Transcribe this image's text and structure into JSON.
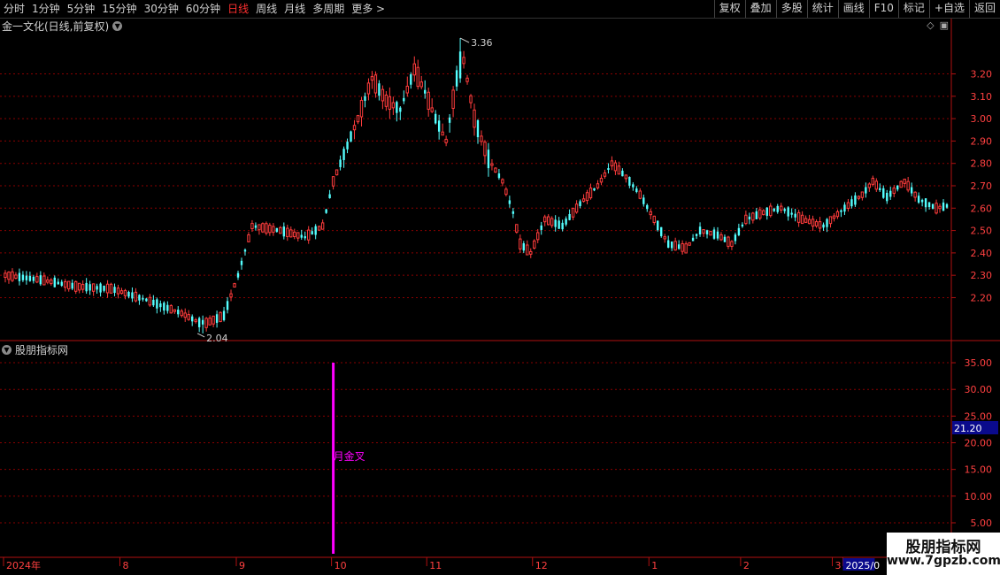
{
  "toolbar": {
    "periods": [
      "分时",
      "1分钟",
      "5分钟",
      "15分钟",
      "30分钟",
      "60分钟",
      "日线",
      "周线",
      "月线",
      "多周期",
      "更多 >"
    ],
    "active_period": "日线",
    "buttons": [
      "复权",
      "叠加",
      "多股",
      "统计",
      "画线",
      "F10",
      "标记",
      "+自选",
      "返回"
    ]
  },
  "stock_title": "金一文化(日线,前复权)",
  "indicator_title": "股朋指标网",
  "watermark": {
    "line1": "股朋指标网",
    "line2": "www.7gpzb.com"
  },
  "colors": {
    "up": "#ff3c3c",
    "down": "#54ffff",
    "grid": "#8a0000",
    "border": "#b01010",
    "signal": "#ff00ff",
    "badge": "#0a0a8c"
  },
  "chart_data": {
    "type": "candlestick",
    "y_ticks": [
      2.2,
      2.3,
      2.4,
      2.5,
      2.6,
      2.7,
      2.8,
      2.9,
      3.0,
      3.1,
      3.2
    ],
    "y_tick_labels": [
      "2.20",
      "2.30",
      "2.40",
      "2.50",
      "2.60",
      "2.70",
      "2.80",
      "2.90",
      "3.00",
      "3.10",
      "3.20"
    ],
    "ylim": [
      2.02,
      3.38
    ],
    "high_annotation": {
      "label": "3.36",
      "value": 3.36,
      "index": 129
    },
    "low_annotation": {
      "label": "2.04",
      "value": 2.04,
      "index": 56
    },
    "x_labels": [
      {
        "label": "2024年",
        "index": 0
      },
      {
        "label": "8",
        "index": 33
      },
      {
        "label": "9",
        "index": 66
      },
      {
        "label": "10",
        "index": 93
      },
      {
        "label": "11",
        "index": 120
      },
      {
        "label": "12",
        "index": 150
      },
      {
        "label": "1",
        "index": 183
      },
      {
        "label": "2",
        "index": 209
      },
      {
        "label": "3",
        "index": 235
      },
      {
        "label": "2025/0",
        "index": 238
      }
    ],
    "num_bars": 268,
    "indicator": {
      "y_ticks": [
        5,
        10,
        15,
        20,
        25,
        30,
        35
      ],
      "y_tick_labels": [
        "5.00",
        "10.00",
        "15.00",
        "20.00",
        "25.00",
        "30.00",
        "35.00"
      ],
      "ylim": [
        4.5,
        36
      ],
      "current_value": "21.20",
      "signal": {
        "label": "月金叉",
        "index": 93,
        "from": 4.5,
        "to": 35
      }
    }
  }
}
